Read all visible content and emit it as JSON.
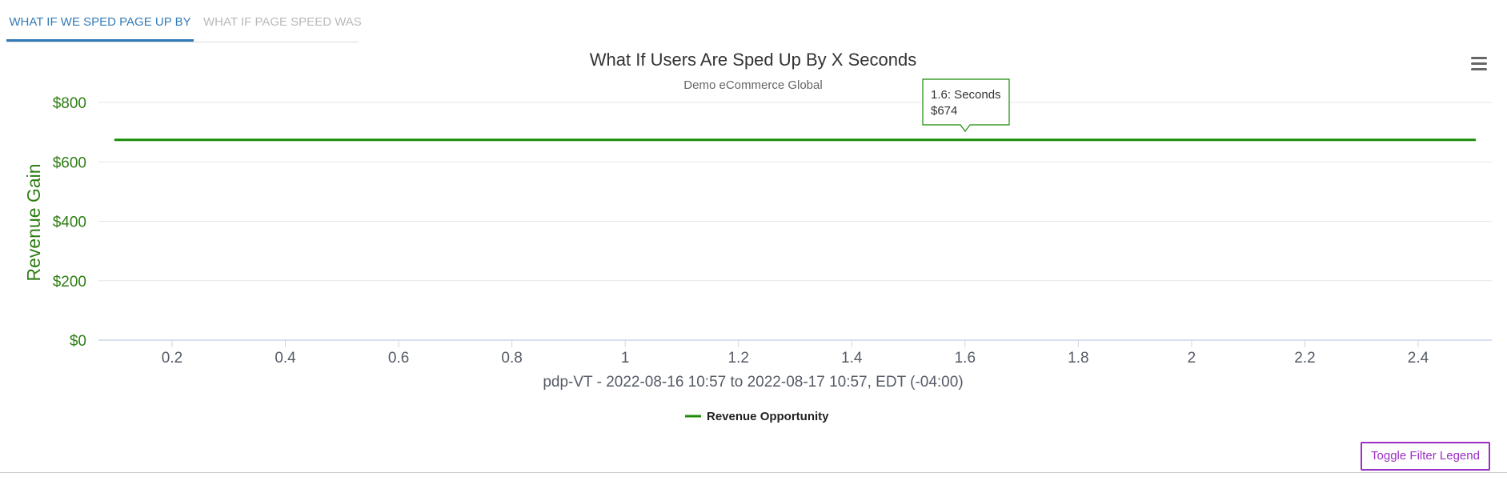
{
  "tabs": [
    {
      "label": "WHAT IF WE SPED PAGE UP BY",
      "active": true
    },
    {
      "label": "WHAT IF PAGE SPEED WAS",
      "active": false
    }
  ],
  "menu_icon": "hamburger-menu-icon",
  "toggle_button": {
    "label": "Toggle Filter Legend"
  },
  "colors": {
    "series": "#1a8c08",
    "axis_text": "#2e7d14",
    "tab_active": "#337ab7",
    "button": "#9b30c4"
  },
  "chart_data": {
    "type": "line",
    "title": "What If Users Are Sped Up By X Seconds",
    "subtitle": "Demo eCommerce Global",
    "xlabel": "pdp-VT - 2022-08-16 10:57 to 2022-08-17 10:57, EDT (-04:00)",
    "ylabel": "Revenue Gain",
    "xlim": [
      0.07,
      2.53
    ],
    "ylim": [
      0,
      800
    ],
    "x_ticks": [
      0.2,
      0.4,
      0.6,
      0.8,
      1,
      1.2,
      1.4,
      1.6,
      1.8,
      2,
      2.2,
      2.4
    ],
    "y_ticks": [
      0,
      200,
      400,
      600,
      800
    ],
    "y_tick_labels": [
      "$0",
      "$200",
      "$400",
      "$600",
      "$800"
    ],
    "grid": true,
    "legend_position": "bottom-center",
    "series": [
      {
        "name": "Revenue Opportunity",
        "x": [
          0.1,
          0.2,
          0.3,
          0.4,
          0.5,
          0.6,
          0.7,
          0.8,
          0.9,
          1,
          1.1,
          1.2,
          1.3,
          1.4,
          1.5,
          1.6,
          1.7,
          1.8,
          1.9,
          2,
          2.1,
          2.2,
          2.3,
          2.4,
          2.5
        ],
        "values": [
          674,
          674,
          674,
          674,
          674,
          674,
          674,
          674,
          674,
          674,
          674,
          674,
          674,
          674,
          674,
          674,
          674,
          674,
          674,
          674,
          674,
          674,
          674,
          674,
          674
        ]
      }
    ],
    "tooltip": {
      "x": 1.6,
      "line1": "1.6: Seconds",
      "line2": "$674"
    }
  }
}
